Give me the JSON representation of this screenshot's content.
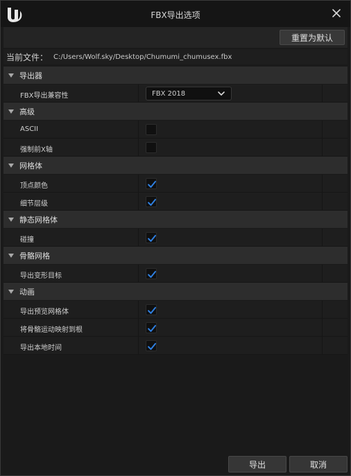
{
  "window": {
    "title": "FBX导出选项"
  },
  "toolbar": {
    "reset_label": "重置为默认"
  },
  "file": {
    "label": "当前文件：",
    "path": "C:/Users/Wolf.sky/Desktop/Chumumi_chumusex.fbx"
  },
  "categories": [
    {
      "name": "导出器",
      "rows": [
        {
          "label": "FBX导出兼容性",
          "type": "select",
          "value": "FBX 2018"
        }
      ]
    },
    {
      "name": "高级",
      "rows": [
        {
          "label": "ASCII",
          "type": "checkbox",
          "checked": false
        },
        {
          "label": "强制前X轴",
          "type": "checkbox",
          "checked": false
        }
      ]
    },
    {
      "name": "网格体",
      "rows": [
        {
          "label": "顶点颜色",
          "type": "checkbox",
          "checked": true
        },
        {
          "label": "细节层级",
          "type": "checkbox",
          "checked": true
        }
      ]
    },
    {
      "name": "静态网格体",
      "rows": [
        {
          "label": "碰撞",
          "type": "checkbox",
          "checked": true
        }
      ]
    },
    {
      "name": "骨骼网格",
      "rows": [
        {
          "label": "导出变形目标",
          "type": "checkbox",
          "checked": true
        }
      ]
    },
    {
      "name": "动画",
      "rows": [
        {
          "label": "导出预览网格体",
          "type": "checkbox",
          "checked": true
        },
        {
          "label": "将骨骼运动映射到根",
          "type": "checkbox",
          "checked": true
        },
        {
          "label": "导出本地时间",
          "type": "checkbox",
          "checked": true
        }
      ]
    }
  ],
  "footer": {
    "export_label": "导出",
    "cancel_label": "取消"
  },
  "colors": {
    "check": "#2f7fe0",
    "background": "#1a1a1a",
    "category": "#2d2d2d"
  }
}
